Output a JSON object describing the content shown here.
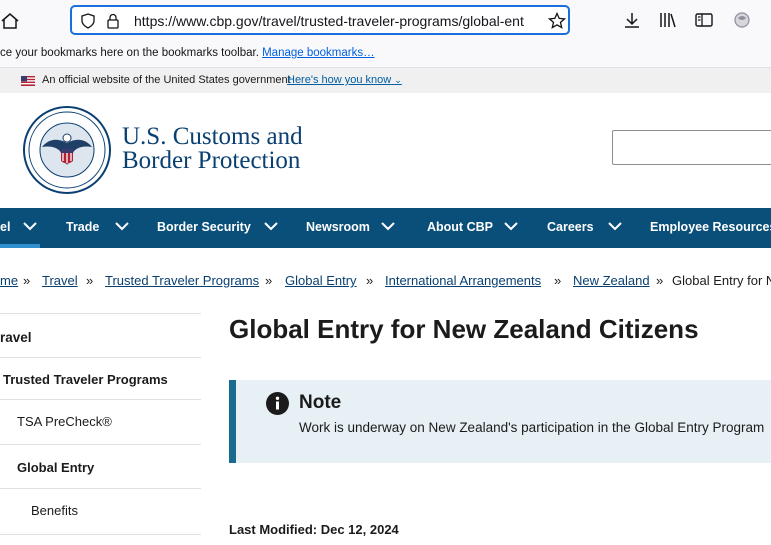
{
  "browser": {
    "url": "https://www.cbp.gov/travel/trusted-traveler-programs/global-ent",
    "bookmarks_text": "ce your bookmarks here on the bookmarks toolbar.",
    "bookmarks_link": "Manage bookmarks…"
  },
  "gov_banner": {
    "text": "An official website of the United States government",
    "link": "Here's how you know"
  },
  "header": {
    "agency_line1": "U.S. Customs and",
    "agency_line2": "Border Protection",
    "search_placeholder": ""
  },
  "nav": {
    "items": [
      "el",
      "Trade",
      "Border Security",
      "Newsroom",
      "About CBP",
      "Careers",
      "Employee Resources"
    ]
  },
  "breadcrumb": {
    "items": [
      "me",
      "Travel",
      "Trusted Traveler Programs",
      "Global Entry",
      "International Arrangements",
      "New Zealand"
    ],
    "current": "Global Entry for N",
    "separator": "»"
  },
  "sidebar": {
    "items": [
      "ravel",
      "Trusted Traveler Programs",
      "TSA PreCheck®",
      "Global Entry",
      "Benefits"
    ]
  },
  "main": {
    "title": "Global Entry for New Zealand Citizens",
    "note_title": "Note",
    "note_text": "Work is underway on New Zealand's participation in the Global Entry Program",
    "last_modified": "Last Modified: Dec 12, 2024"
  },
  "colors": {
    "nav_bg": "#0a4f7a",
    "link": "#0a3f72",
    "note_bg": "#e6f0f5",
    "note_border": "#1a6a90"
  }
}
